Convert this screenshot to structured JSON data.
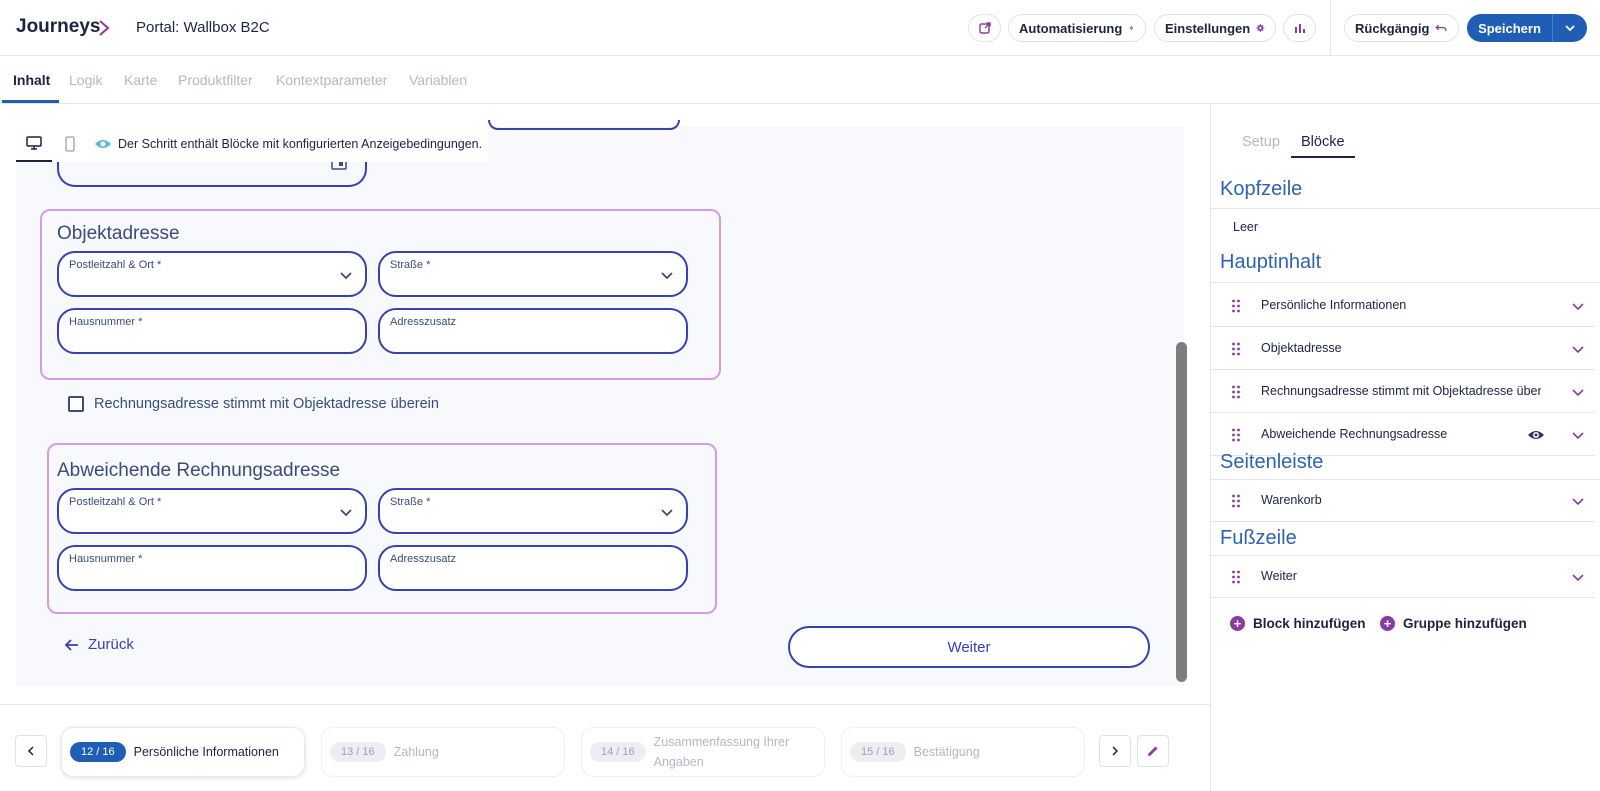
{
  "topbar": {
    "brand": "Journeys",
    "portal": "Portal: Wallbox B2C",
    "automation_label": "Automatisierung",
    "settings_label": "Einstellungen",
    "undo_label": "Rückgängig",
    "save_label": "Speichern"
  },
  "tabs": [
    "Inhalt",
    "Logik",
    "Karte",
    "Produktfilter",
    "Kontextparameter",
    "Variablen"
  ],
  "canvas": {
    "condition_notice": "Der Schritt enthält Blöcke mit konfigurierten Anzeigebedingungen.",
    "object_address": {
      "title": "Objektadresse",
      "fields": [
        "Postleitzahl & Ort *",
        "Straße *",
        "Hausnummer *",
        "Adresszusatz"
      ]
    },
    "checkbox_label": "Rechnungsadresse stimmt mit Objektadresse überein",
    "billing_address": {
      "title": "Abweichende Rechnungsadresse",
      "fields": [
        "Postleitzahl & Ort *",
        "Straße *",
        "Hausnummer *",
        "Adresszusatz"
      ]
    },
    "back_label": "Zurück",
    "next_label": "Weiter"
  },
  "stepper": {
    "steps": [
      {
        "badge": "12 / 16",
        "label": "Persönliche Informationen",
        "current": true
      },
      {
        "badge": "13 / 16",
        "label": "Zahlung",
        "current": false
      },
      {
        "badge": "14 / 16",
        "label": "Zusammenfassung Ihrer Angaben",
        "current": false
      },
      {
        "badge": "15 / 16",
        "label": "Bestätigung",
        "current": false
      }
    ]
  },
  "rpanel": {
    "tabs": [
      "Setup",
      "Blöcke"
    ],
    "header_title": "Kopfzeile",
    "header_empty": "Leer",
    "main_title": "Hauptinhalt",
    "main_blocks": [
      "Persönliche Informationen",
      "Objektadresse",
      "Rechnungsadresse stimmt mit Objektadresse über",
      "Abweichende Rechnungsadresse"
    ],
    "sidebar_title": "Seitenleiste",
    "sidebar_blocks": [
      "Warenkorb"
    ],
    "footer_title": "Fußzeile",
    "footer_blocks": [
      "Weiter"
    ],
    "add_block": "Block hinzufügen",
    "add_group": "Gruppe hinzufügen"
  },
  "icons": {
    "chevron_right": "chevron-right-icon",
    "external_link": "external-link-icon",
    "lightning": "lightning-icon",
    "gear": "gear-icon",
    "bar_chart": "bar-chart-icon",
    "undo": "undo-icon",
    "desktop": "desktop-icon",
    "mobile": "mobile-icon",
    "eye": "eye-icon",
    "pencil": "pencil-icon",
    "drag_handle": "drag-handle-icon",
    "plus": "plus-icon"
  },
  "colors": {
    "primary": "#1f5eb4",
    "accent_purple": "#8a3aa0",
    "field_border": "#3a3fb1",
    "group_border": "#d59be8",
    "section_blue": "#2f63ad"
  }
}
